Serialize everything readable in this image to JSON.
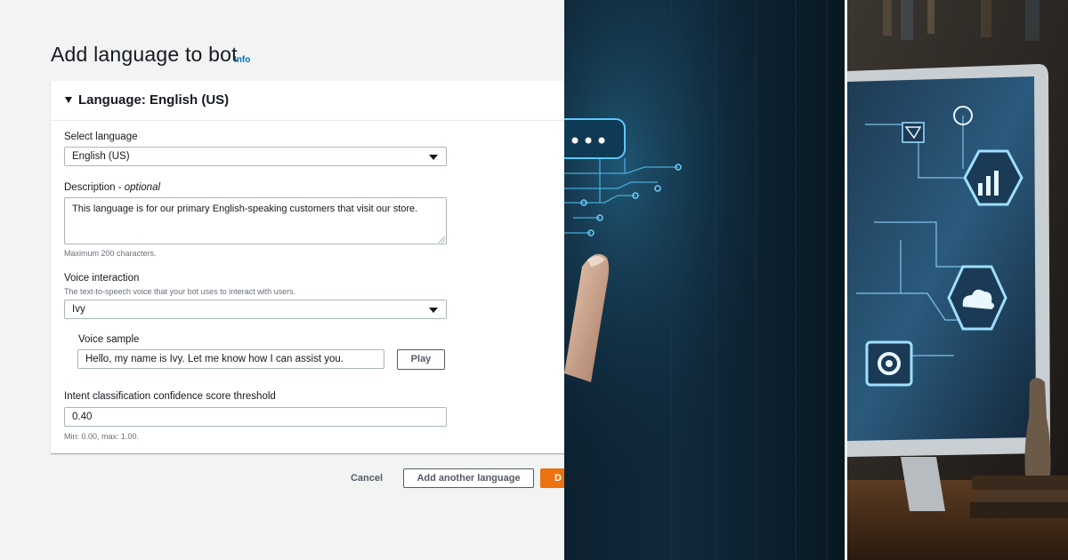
{
  "page": {
    "title": "Add language to bot",
    "info_link": "Info"
  },
  "language_section": {
    "header": "Language: English (US)",
    "select_language": {
      "label": "Select language",
      "value": "English (US)"
    },
    "description": {
      "label": "Description - ",
      "label_optional": "optional",
      "value": "This language is for our primary English-speaking customers that visit our store.",
      "hint": "Maximum 200 characters."
    },
    "voice_interaction": {
      "label": "Voice interaction",
      "hint": "The text-to-speech voice that your bot uses to interact with users.",
      "value": "Ivy"
    },
    "voice_sample": {
      "label": "Voice sample",
      "value": "Hello, my name is Ivy. Let me know how I can assist you.",
      "play_label": "Play"
    },
    "confidence": {
      "label": "Intent classification confidence score threshold",
      "value": "0.40",
      "hint": "Min: 0.00, max: 1.00."
    }
  },
  "footer": {
    "cancel_label": "Cancel",
    "add_another_label": "Add another language",
    "done_label": "D"
  },
  "colors": {
    "primary": "#ec7211",
    "link": "#0073bb",
    "text": "#16191f",
    "secondary_text": "#687078",
    "background": "#f2f3f3"
  }
}
